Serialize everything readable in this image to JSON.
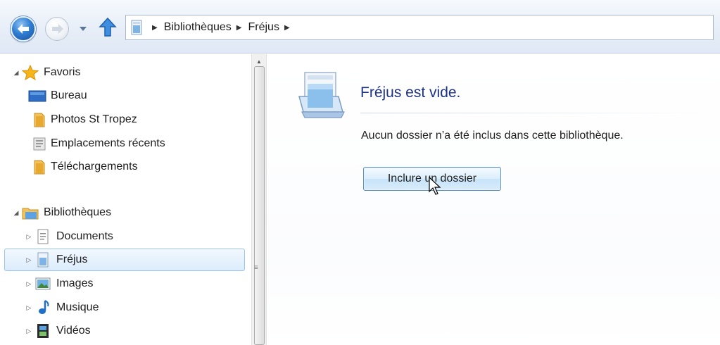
{
  "address_bar": {
    "breadcrumbs": [
      "Bibliothèques",
      "Fréjus"
    ]
  },
  "navigation_pane": {
    "favorites": {
      "label": "Favoris",
      "icon": "star-icon",
      "items": [
        {
          "label": "Bureau",
          "icon": "desktop-icon"
        },
        {
          "label": "Photos St Tropez",
          "icon": "folder-icon"
        },
        {
          "label": "Emplacements récents",
          "icon": "recent-places-icon"
        },
        {
          "label": "Téléchargements",
          "icon": "folder-icon"
        }
      ]
    },
    "libraries": {
      "label": "Bibliothèques",
      "icon": "libraries-icon",
      "items": [
        {
          "label": "Documents",
          "icon": "documents-library-icon"
        },
        {
          "label": "Fréjus",
          "icon": "library-icon",
          "selected": true
        },
        {
          "label": "Images",
          "icon": "pictures-library-icon"
        },
        {
          "label": "Musique",
          "icon": "music-library-icon"
        },
        {
          "label": "Vidéos",
          "icon": "videos-library-icon"
        }
      ]
    }
  },
  "content": {
    "title": "Fréjus est vide.",
    "description": "Aucun dossier n’a été inclus dans cette bibliothèque.",
    "include_button": "Inclure un dossier"
  },
  "colors": {
    "title_text": "#1e3287",
    "selection_border": "#9ac6ee",
    "button_border": "#5a8fc8",
    "nav_back_blue": "#2f7fd4"
  }
}
